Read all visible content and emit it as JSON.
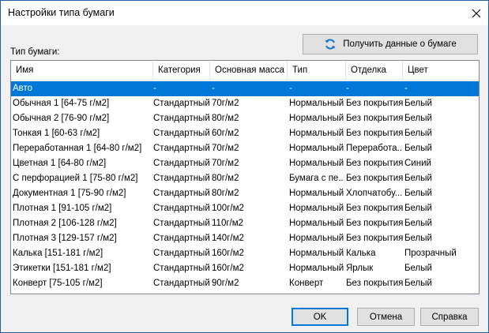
{
  "window": {
    "title": "Настройки типа бумаги"
  },
  "toolbar": {
    "get_info_label": "Получить данные о бумаге"
  },
  "paper_type_label": "Тип бумаги:",
  "columns": [
    "Имя",
    "Категория",
    "Основная масса",
    "Тип",
    "Отделка",
    "Цвет"
  ],
  "rows": [
    [
      "Авто",
      "-",
      "-",
      "-",
      "-",
      "-"
    ],
    [
      "Обычная 1 [64-75 г/м2]",
      "Стандартный",
      "70г/м2",
      "Нормальный",
      "Без покрытия",
      "Белый"
    ],
    [
      "Обычная 2 [76-90 г/м2]",
      "Стандартный",
      "80г/м2",
      "Нормальный",
      "Без покрытия",
      "Белый"
    ],
    [
      "Тонкая 1 [60-63 г/м2]",
      "Стандартный",
      "60г/м2",
      "Нормальный",
      "Без покрытия",
      "Белый"
    ],
    [
      "Переработанная 1 [64-80 г/м2]",
      "Стандартный",
      "70г/м2",
      "Нормальный",
      "Переработа...",
      "Белый"
    ],
    [
      "Цветная 1 [64-80 г/м2]",
      "Стандартный",
      "70г/м2",
      "Нормальный",
      "Без покрытия",
      "Синий"
    ],
    [
      "С перфорацией 1 [75-80 г/м2]",
      "Стандартный",
      "80г/м2",
      "Бумага с пе...",
      "Без покрытия",
      "Белый"
    ],
    [
      "Документная 1 [75-90 г/м2]",
      "Стандартный",
      "80г/м2",
      "Нормальный",
      "Хлопчатобу...",
      "Белый"
    ],
    [
      "Плотная 1 [91-105 г/м2]",
      "Стандартный",
      "100г/м2",
      "Нормальный",
      "Без покрытия",
      "Белый"
    ],
    [
      "Плотная 2 [106-128 г/м2]",
      "Стандартный",
      "110г/м2",
      "Нормальный",
      "Без покрытия",
      "Белый"
    ],
    [
      "Плотная 3 [129-157 г/м2]",
      "Стандартный",
      "140г/м2",
      "Нормальный",
      "Без покрытия",
      "Белый"
    ],
    [
      "Калька [151-181 г/м2]",
      "Стандартный",
      "160г/м2",
      "Нормальный",
      "Калька",
      "Прозрачный"
    ],
    [
      "Этикетки [151-181 г/м2]",
      "Стандартный",
      "160г/м2",
      "Нормальный",
      "Ярлык",
      "Белый"
    ],
    [
      "Конверт [75-105 г/м2]",
      "Стандартный",
      "90г/м2",
      "Конверт",
      "Без покрытия",
      "Белый"
    ]
  ],
  "selected_row": 0,
  "buttons": {
    "ok": "OK",
    "cancel": "Отмена",
    "help": "Справка"
  },
  "colors": {
    "selection": "#0078d7",
    "default_button_border": "#0078d7",
    "window_border": "#1f5fa8"
  },
  "icons": {
    "close": "close-icon",
    "refresh": "refresh-icon"
  }
}
